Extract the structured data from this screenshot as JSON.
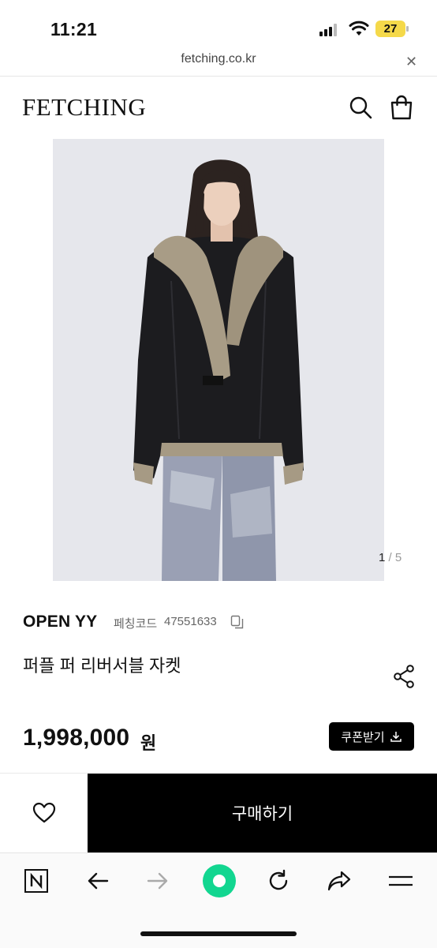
{
  "status_bar": {
    "time": "11:21",
    "battery": "27",
    "battery_color": "#f5d94a"
  },
  "browser": {
    "url": "fetching.co.kr",
    "close_label": "✕"
  },
  "header": {
    "logo": "FETCHING"
  },
  "product": {
    "image_counter": {
      "current": "1",
      "separator": " / ",
      "total": "5"
    },
    "brand": "OPEN YY",
    "code_label": "페칭코드",
    "code_value": "47551633",
    "name": "퍼플 퍼 리버서블 자켓",
    "price": "1,998,000",
    "price_unit": "원",
    "coupon_label": "쿠폰받기"
  },
  "cta": {
    "buy_label": "구매하기"
  },
  "toolbar": {
    "items": [
      "n-home-icon",
      "back-arrow-icon",
      "forward-arrow-icon",
      "green-dot-icon",
      "reload-icon",
      "share-arrow-icon",
      "menu-icon"
    ],
    "accent": "#12d690"
  }
}
